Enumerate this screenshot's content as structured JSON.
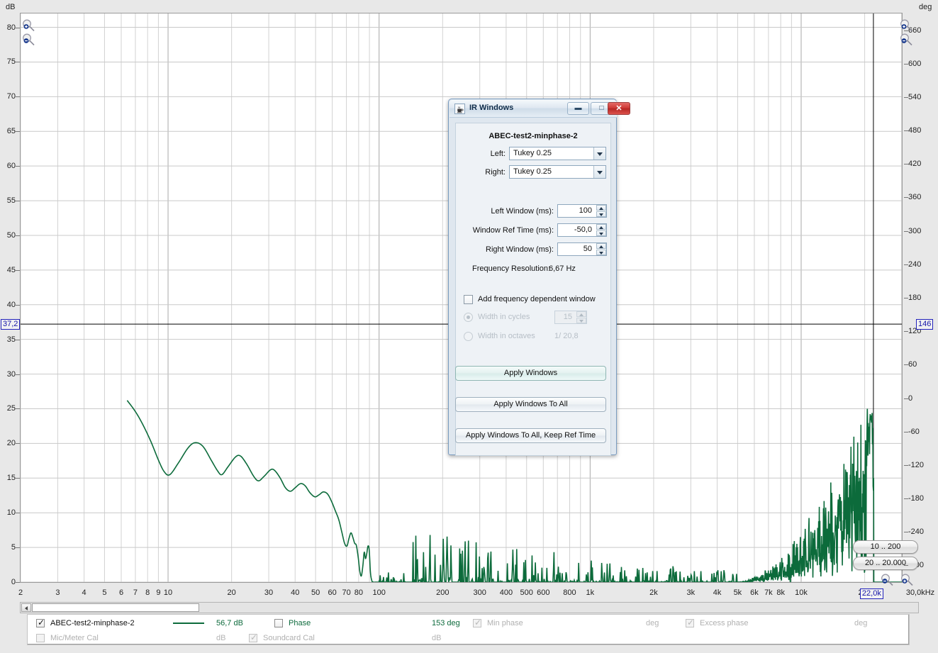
{
  "chart_data": {
    "type": "line",
    "title": "",
    "xlabel": "",
    "ylabel": "dB",
    "y2label": "deg",
    "xscale": "log",
    "xlim": [
      2,
      30000
    ],
    "xunit": "30,0kHz",
    "ylim": [
      0,
      82
    ],
    "y2lim": [
      -330,
      690
    ],
    "grid": true,
    "x_ticks": [
      {
        "v": 2,
        "label": "2"
      },
      {
        "v": 3,
        "label": "3"
      },
      {
        "v": 4,
        "label": "4"
      },
      {
        "v": 5,
        "label": "5"
      },
      {
        "v": 6,
        "label": "6"
      },
      {
        "v": 7,
        "label": "7"
      },
      {
        "v": 8,
        "label": "8"
      },
      {
        "v": 9,
        "label": "9"
      },
      {
        "v": 10,
        "label": "10"
      },
      {
        "v": 20,
        "label": "20"
      },
      {
        "v": 30,
        "label": "30"
      },
      {
        "v": 40,
        "label": "40"
      },
      {
        "v": 50,
        "label": "50"
      },
      {
        "v": 60,
        "label": "60"
      },
      {
        "v": 70,
        "label": "70"
      },
      {
        "v": 80,
        "label": "80"
      },
      {
        "v": 100,
        "label": "100"
      },
      {
        "v": 200,
        "label": "200"
      },
      {
        "v": 300,
        "label": "300"
      },
      {
        "v": 400,
        "label": "400"
      },
      {
        "v": 500,
        "label": "500"
      },
      {
        "v": 600,
        "label": "600"
      },
      {
        "v": 800,
        "label": "800"
      },
      {
        "v": 1000,
        "label": "1k"
      },
      {
        "v": 2000,
        "label": "2k"
      },
      {
        "v": 3000,
        "label": "3k"
      },
      {
        "v": 4000,
        "label": "4k"
      },
      {
        "v": 5000,
        "label": "5k"
      },
      {
        "v": 6000,
        "label": "6k"
      },
      {
        "v": 7000,
        "label": "7k"
      },
      {
        "v": 8000,
        "label": "8k"
      },
      {
        "v": 10000,
        "label": "10k"
      },
      {
        "v": 20000,
        "label": "2"
      },
      {
        "v": 30000,
        "label": "30,0kHz"
      }
    ],
    "y_left_ticks": [
      0,
      5,
      10,
      15,
      20,
      25,
      30,
      35,
      40,
      45,
      50,
      55,
      60,
      65,
      70,
      75,
      80
    ],
    "y_right_ticks": [
      -300,
      -240,
      -180,
      -120,
      -60,
      0,
      60,
      120,
      180,
      240,
      300,
      360,
      420,
      480,
      540,
      600,
      660
    ],
    "cursor": {
      "y_left_value": "37,2",
      "y_right_value": "146",
      "x_value": "22,0k"
    },
    "series": [
      {
        "name": "ABEC-test2-minphase-2",
        "color": "#0c6b3b",
        "unit": "dB"
      }
    ],
    "annotations": {
      "vertical_cursor_freq": "22,0k",
      "horizontal_cursor_db": "37,2"
    }
  },
  "axes": {
    "left_unit": "dB",
    "right_unit": "deg",
    "x_end_label": "30,0kHz"
  },
  "plot_buttons": [
    {
      "label": "10 .. 200"
    },
    {
      "label": "20 .. 20.000"
    }
  ],
  "zoom_icons": {
    "zoom_in": "zoom-in-icon",
    "zoom_out": "zoom-out-icon"
  },
  "legend": {
    "rows": [
      {
        "checkbox_checked": true,
        "checkbox_enabled": true,
        "label": "ABEC-test2-minphase-2",
        "has_swatch": true,
        "value": "56,7 dB",
        "label_style": "dark",
        "second": {
          "checkbox_checked": false,
          "checkbox_enabled": true,
          "label": "Phase",
          "value": "153 deg",
          "label_style": "green"
        },
        "third": {
          "checkbox_checked": true,
          "checkbox_enabled": false,
          "label": "Min phase",
          "value": "deg",
          "label_style": "grey"
        }
      },
      {
        "checkbox_checked": false,
        "checkbox_enabled": false,
        "label": "Mic/Meter Cal",
        "has_swatch": false,
        "value": "dB",
        "label_style": "grey",
        "second": {
          "checkbox_checked": true,
          "checkbox_enabled": false,
          "label": "Soundcard Cal",
          "value": "dB",
          "label_style": "grey"
        },
        "third": {
          "checkbox_checked": true,
          "checkbox_enabled": false,
          "label": "Excess phase",
          "value": "deg",
          "label_style": "grey"
        }
      }
    ]
  },
  "dialog": {
    "title": "IR Windows",
    "icon": "java-cup-icon",
    "window_buttons": {
      "minimize": "–",
      "maximize": "□",
      "close": "✕"
    },
    "measurement_name": "ABEC-test2-minphase-2",
    "left_label": "Left:",
    "left_value": "Tukey 0.25",
    "right_label": "Right:",
    "right_value": "Tukey 0.25",
    "fields": [
      {
        "label": "Left Window (ms):",
        "value": "100"
      },
      {
        "label": "Window Ref Time (ms):",
        "value": "-50,0"
      },
      {
        "label": "Right Window (ms):",
        "value": "50"
      }
    ],
    "freq_resolution_label": "Frequency Resolution:",
    "freq_resolution_value": "6,67 Hz",
    "add_fdw_label": "Add frequency dependent window",
    "add_fdw_checked": false,
    "width_cycles_label": "Width in cycles",
    "width_cycles_value": "15",
    "width_cycles_selected": true,
    "width_octaves_label": "Width in octaves",
    "width_octaves_value": "1/ 20,8",
    "buttons": [
      {
        "label": "Apply Windows",
        "primary": true
      },
      {
        "label": "Apply Windows To All",
        "primary": false
      },
      {
        "label": "Apply Windows To All, Keep Ref Time",
        "primary": false
      }
    ]
  }
}
